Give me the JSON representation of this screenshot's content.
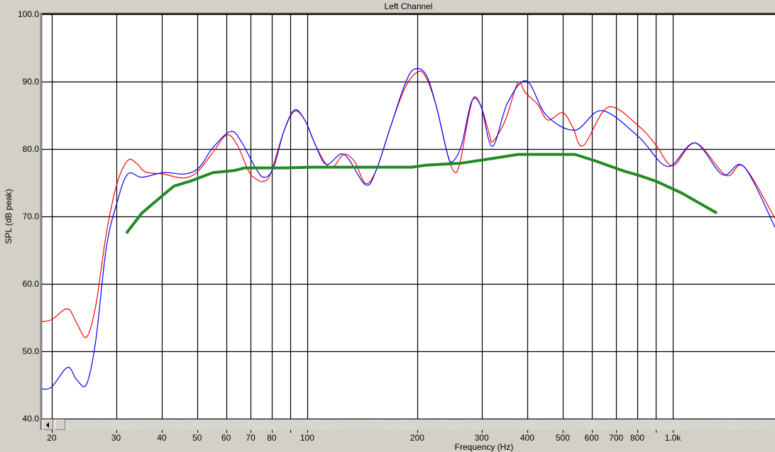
{
  "chart_data": {
    "type": "line",
    "title": "Left Channel",
    "xlabel": "Frequency (Hz)",
    "ylabel": "SPL (dB peak)",
    "xscale": "log",
    "xlim": [
      18.8,
      1904
    ],
    "ylim": [
      40,
      100
    ],
    "grid": true,
    "x_gridlines": [
      20,
      30,
      40,
      50,
      60,
      70,
      80,
      90,
      100,
      200,
      300,
      400,
      500,
      600,
      700,
      800,
      900,
      1000
    ],
    "x_ticks": [
      {
        "value": 20,
        "label": "20"
      },
      {
        "value": 30,
        "label": "30"
      },
      {
        "value": 40,
        "label": "40"
      },
      {
        "value": 50,
        "label": "50"
      },
      {
        "value": 60,
        "label": "60"
      },
      {
        "value": 70,
        "label": "70"
      },
      {
        "value": 80,
        "label": "80"
      },
      {
        "value": 100,
        "label": "100"
      },
      {
        "value": 200,
        "label": "200"
      },
      {
        "value": 300,
        "label": "300"
      },
      {
        "value": 400,
        "label": "400"
      },
      {
        "value": 500,
        "label": "500"
      },
      {
        "value": 600,
        "label": "600"
      },
      {
        "value": 700,
        "label": "700"
      },
      {
        "value": 800,
        "label": "800"
      },
      {
        "value": 1000,
        "label": "1.0k"
      }
    ],
    "y_ticks": [
      {
        "value": 100,
        "label": "100.0"
      },
      {
        "value": 90,
        "label": "90.0"
      },
      {
        "value": 80,
        "label": "80.0"
      },
      {
        "value": 70,
        "label": "70.0"
      },
      {
        "value": 60,
        "label": "60.0"
      },
      {
        "value": 50,
        "label": "50.0"
      },
      {
        "value": 40,
        "label": "40.0"
      }
    ],
    "series": [
      {
        "name": "red",
        "color": "#ff0000",
        "points": [
          [
            18.8,
            54.4
          ],
          [
            20,
            54.7
          ],
          [
            22.1,
            56.3
          ],
          [
            23.4,
            54.2
          ],
          [
            24.9,
            52.1
          ],
          [
            26.4,
            56.8
          ],
          [
            28.2,
            67.4
          ],
          [
            30.2,
            74.9
          ],
          [
            32.3,
            78.3
          ],
          [
            34.1,
            77.9
          ],
          [
            36.1,
            76.6
          ],
          [
            40.4,
            76.3
          ],
          [
            44.1,
            75.8
          ],
          [
            47.2,
            75.8
          ],
          [
            50.5,
            76.8
          ],
          [
            55.2,
            79.5
          ],
          [
            60.3,
            82.1
          ],
          [
            64.5,
            80.5
          ],
          [
            69,
            76.8
          ],
          [
            72.2,
            75.6
          ],
          [
            76.1,
            75.2
          ],
          [
            79.6,
            76.5
          ],
          [
            86.3,
            82.6
          ],
          [
            92.3,
            85.6
          ],
          [
            98.7,
            84.2
          ],
          [
            105.5,
            80.5
          ],
          [
            112.9,
            77.7
          ],
          [
            118,
            77.4
          ],
          [
            126.2,
            79.2
          ],
          [
            135,
            78.1
          ],
          [
            144.3,
            74.9
          ],
          [
            154.3,
            76.8
          ],
          [
            168.8,
            83.2
          ],
          [
            184.5,
            88.9
          ],
          [
            200,
            91.4
          ],
          [
            211,
            90.7
          ],
          [
            225.6,
            86.3
          ],
          [
            241.3,
            79.5
          ],
          [
            252.5,
            76.6
          ],
          [
            261.6,
            77.9
          ],
          [
            276,
            84.7
          ],
          [
            286,
            87.7
          ],
          [
            299,
            86.3
          ],
          [
            315.5,
            82.1
          ],
          [
            322,
            81.1
          ],
          [
            348,
            84.2
          ],
          [
            377,
            89.8
          ],
          [
            394.5,
            88.4
          ],
          [
            427,
            86.6
          ],
          [
            455,
            84.3
          ],
          [
            500,
            85.4
          ],
          [
            533,
            83.2
          ],
          [
            569,
            80.5
          ],
          [
            666,
            86.2
          ],
          [
            807,
            83.4
          ],
          [
            902,
            80.5
          ],
          [
            1000,
            77.5
          ],
          [
            1154,
            80.9
          ],
          [
            1399,
            76.1
          ],
          [
            1564,
            77.4
          ],
          [
            1904,
            69.7
          ]
        ]
      },
      {
        "name": "blue",
        "color": "#0000ff",
        "points": [
          [
            18.8,
            44.4
          ],
          [
            20,
            44.7
          ],
          [
            22.1,
            47.6
          ],
          [
            23.4,
            45.8
          ],
          [
            24.9,
            45.1
          ],
          [
            26.4,
            51.6
          ],
          [
            28.2,
            65.3
          ],
          [
            30.2,
            72.1
          ],
          [
            32.3,
            76.3
          ],
          [
            35.3,
            75.8
          ],
          [
            40.4,
            76.5
          ],
          [
            46.1,
            76.3
          ],
          [
            50.5,
            77.2
          ],
          [
            55.2,
            80.2
          ],
          [
            61.7,
            82.6
          ],
          [
            66,
            81.1
          ],
          [
            72.2,
            77.2
          ],
          [
            76.1,
            75.8
          ],
          [
            80.7,
            77.1
          ],
          [
            86.3,
            82.6
          ],
          [
            92.3,
            85.8
          ],
          [
            98.7,
            84.2
          ],
          [
            105.5,
            80.5
          ],
          [
            112.9,
            77.7
          ],
          [
            126.2,
            79.2
          ],
          [
            144.3,
            74.7
          ],
          [
            154.3,
            76.8
          ],
          [
            168.8,
            83.2
          ],
          [
            184.5,
            89.4
          ],
          [
            195.6,
            91.8
          ],
          [
            211,
            91.1
          ],
          [
            225.6,
            86.3
          ],
          [
            241.3,
            79.5
          ],
          [
            249,
            78.1
          ],
          [
            264,
            80.5
          ],
          [
            282,
            87.1
          ],
          [
            299,
            86.3
          ],
          [
            321,
            80.4
          ],
          [
            353,
            86.8
          ],
          [
            398,
            90.1
          ],
          [
            451,
            85.0
          ],
          [
            540,
            82.8
          ],
          [
            640,
            85.7
          ],
          [
            807,
            81.8
          ],
          [
            969,
            77.4
          ],
          [
            1149,
            80.9
          ],
          [
            1368,
            76.2
          ],
          [
            1564,
            77.4
          ],
          [
            1904,
            68.4
          ]
        ]
      },
      {
        "name": "green",
        "color": "#228b22",
        "points": [
          [
            32,
            67.5
          ],
          [
            35.3,
            70.5
          ],
          [
            40.4,
            73.2
          ],
          [
            43.2,
            74.5
          ],
          [
            48.3,
            75.3
          ],
          [
            55.2,
            76.5
          ],
          [
            63.1,
            76.8
          ],
          [
            67.5,
            77.2
          ],
          [
            86.3,
            77.2
          ],
          [
            103,
            77.3
          ],
          [
            193,
            77.3
          ],
          [
            211,
            77.6
          ],
          [
            264,
            77.9
          ],
          [
            330,
            78.7
          ],
          [
            377,
            79.2
          ],
          [
            540,
            79.2
          ],
          [
            617,
            78.2
          ],
          [
            738,
            76.7
          ],
          [
            807,
            76.1
          ],
          [
            902,
            75.2
          ],
          [
            1055,
            73.5
          ],
          [
            1320,
            70.5
          ]
        ]
      }
    ]
  }
}
